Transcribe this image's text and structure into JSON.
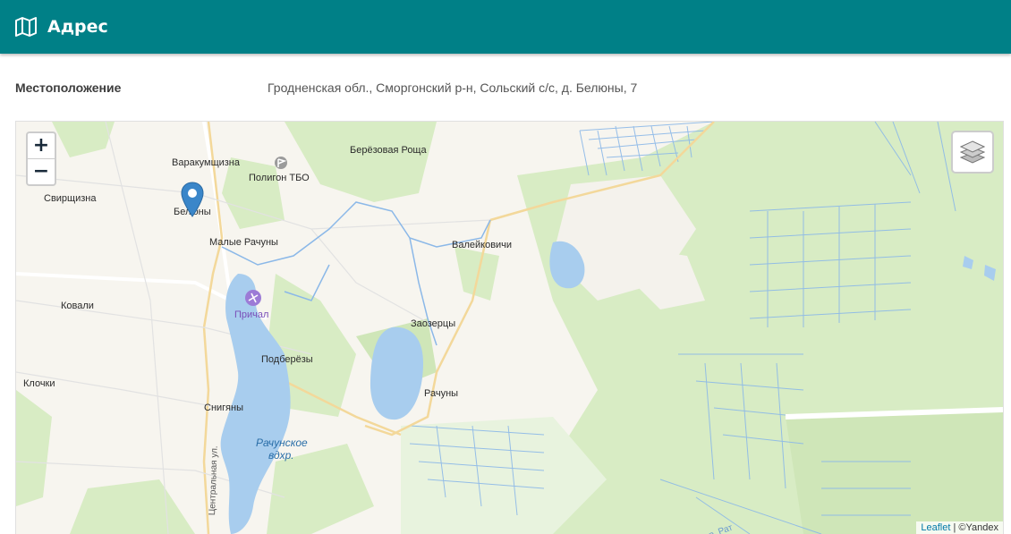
{
  "header": {
    "title": "Адрес",
    "icon": "map-icon"
  },
  "field": {
    "label": "Местоположение",
    "value": "Гродненская обл., Сморгонский р-н, Сольский с/с, д. Белюны, 7"
  },
  "map": {
    "zoom_in": "+",
    "zoom_out": "−",
    "attribution_link": "Leaflet",
    "attribution_rest": "| ©Yandex",
    "places": {
      "varakumshchizna": "Варакумщизна",
      "poligon": "Полигон ТБО",
      "berezovaya_roshcha": "Берёзовая Роща",
      "svirshchizna": "Свирщизна",
      "beluny": "Белюны",
      "malye_rachuny": "Малые Рачуны",
      "valeykovichi": "Валейковичи",
      "kovali": "Ковали",
      "prichal": "Причал",
      "zaozertsy": "Заозерцы",
      "podberezy": "Подберёзы",
      "klochki": "Клочки",
      "rachuny": "Рачуны",
      "snigany": "Снигяны",
      "reservoir_1": "Рачунское",
      "reservoir_2": "вдхр.",
      "street": "Центральная ул.",
      "river": "р. Рат"
    }
  }
}
